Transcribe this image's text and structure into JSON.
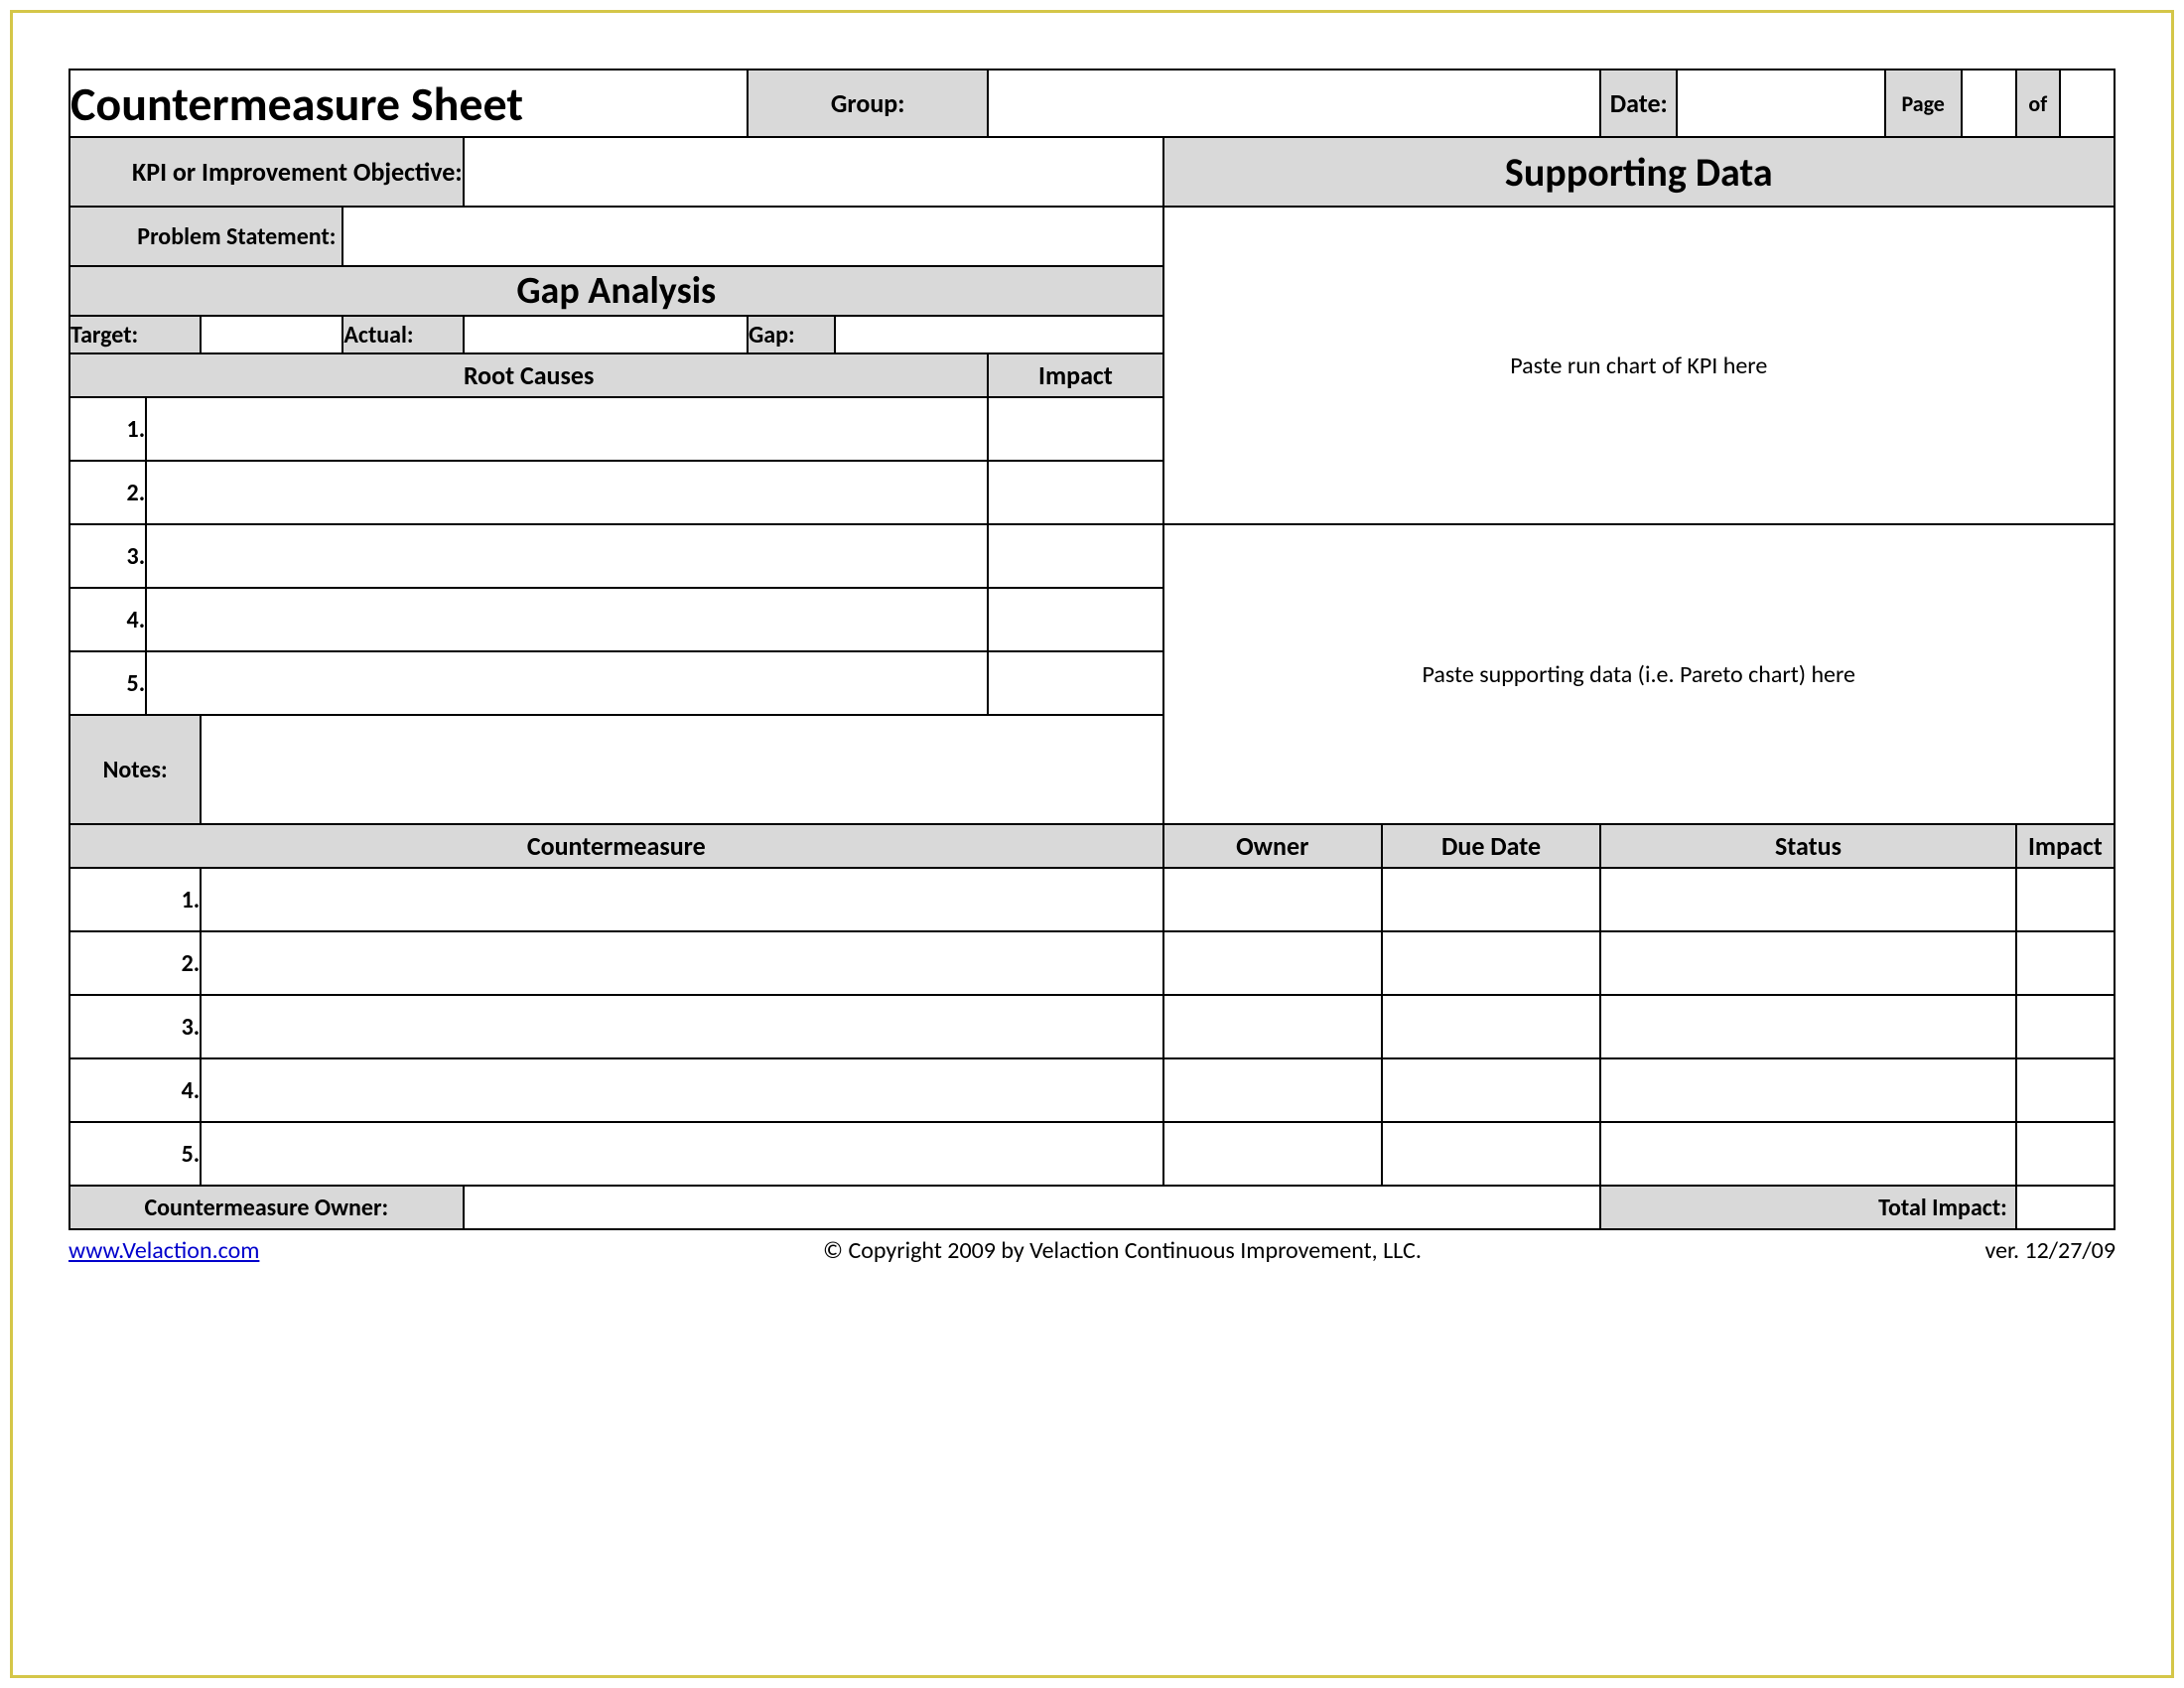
{
  "title": "Countermeasure Sheet",
  "header": {
    "group_label": "Group:",
    "group_value": "",
    "date_label": "Date:",
    "date_value": "",
    "page_label": "Page",
    "page_value": "",
    "of_label": "of",
    "of_value": ""
  },
  "kpi": {
    "label": "KPI or Improvement Objective:",
    "value": ""
  },
  "supporting": {
    "title": "Supporting Data",
    "hint1": "Paste run chart of KPI here",
    "hint2": "Paste supporting data (i.e. Pareto chart) here"
  },
  "problem": {
    "label": "Problem Statement:",
    "value": ""
  },
  "gap": {
    "title": "Gap Analysis",
    "target_label": "Target:",
    "target_value": "",
    "actual_label": "Actual:",
    "actual_value": "",
    "gap_label": "Gap:",
    "gap_value": ""
  },
  "root": {
    "causes_header": "Root Causes",
    "impact_header": "Impact",
    "rows": [
      "1.",
      "2.",
      "3.",
      "4.",
      "5."
    ]
  },
  "notes": {
    "label": "Notes:",
    "value": ""
  },
  "cm": {
    "countermeasure_header": "Countermeasure",
    "owner_header": "Owner",
    "due_header": "Due Date",
    "status_header": "Status",
    "impact_header": "Impact",
    "rows": [
      "1.",
      "2.",
      "3.",
      "4.",
      "5."
    ],
    "owner_label": "Countermeasure Owner:",
    "owner_value": "",
    "total_label": "Total Impact:",
    "total_value": ""
  },
  "footer": {
    "link_text": "www.Velaction.com",
    "copyright": "© Copyright 2009 by Velaction Continuous Improvement, LLC.",
    "version": "ver. 12/27/09"
  }
}
